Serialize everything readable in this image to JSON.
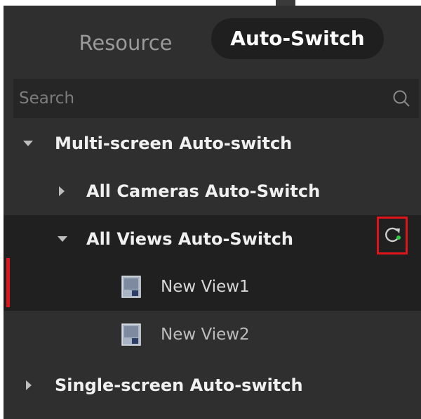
{
  "tabs": [
    {
      "label": "Resource",
      "active": false
    },
    {
      "label": "Auto-Switch",
      "active": true
    }
  ],
  "search": {
    "placeholder": "Search",
    "value": ""
  },
  "tree": {
    "multi_screen": {
      "label": "Multi-screen Auto-switch",
      "expanded": true
    },
    "all_cameras": {
      "label": "All Cameras Auto-Switch",
      "expanded": false
    },
    "all_views": {
      "label": "All Views Auto-Switch",
      "expanded": true
    },
    "views": [
      {
        "label": "New View1",
        "selected": true
      },
      {
        "label": "New View2",
        "selected": false
      }
    ],
    "single_screen": {
      "label": "Single-screen Auto-switch",
      "expanded": false
    }
  },
  "colors": {
    "accent": "#e0141b",
    "panel": "#2f2f2f",
    "highlight_row": "#202020",
    "refresh_green": "#2ecc40"
  },
  "icons": {
    "search": "search-icon",
    "refresh": "refresh-icon",
    "view": "view-icon"
  }
}
